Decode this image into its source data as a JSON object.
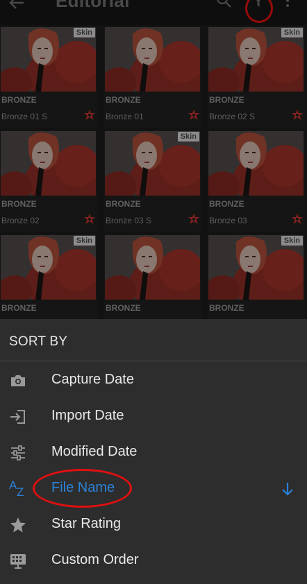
{
  "header": {
    "title": "Editorial",
    "icons": [
      "back-arrow-icon",
      "search-icon",
      "filter-icon",
      "more-vertical-icon"
    ]
  },
  "grid": {
    "tiles": [
      {
        "badge": "Skin",
        "category": "BRONZE",
        "name": "Bronze 01 S"
      },
      {
        "badge": "",
        "category": "BRONZE",
        "name": "Bronze 01"
      },
      {
        "badge": "Skin",
        "category": "BRONZE",
        "name": "Bronze 02 S"
      },
      {
        "badge": "",
        "category": "BRONZE",
        "name": "Bronze 02"
      },
      {
        "badge": "Skin",
        "category": "BRONZE",
        "name": "Bronze 03 S"
      },
      {
        "badge": "",
        "category": "BRONZE",
        "name": "Bronze 03"
      },
      {
        "badge": "Skin",
        "category": "BRONZE",
        "name": ""
      },
      {
        "badge": "",
        "category": "BRONZE",
        "name": ""
      },
      {
        "badge": "Skin",
        "category": "BRONZE",
        "name": ""
      }
    ]
  },
  "sort_sheet": {
    "title": "SORT BY",
    "options": [
      {
        "label": "Capture Date",
        "icon": "camera-icon",
        "active": false
      },
      {
        "label": "Import Date",
        "icon": "import-icon",
        "active": false
      },
      {
        "label": "Modified Date",
        "icon": "sliders-icon",
        "active": false
      },
      {
        "label": "File Name",
        "icon": "az-icon",
        "active": true
      },
      {
        "label": "Star Rating",
        "icon": "star-icon",
        "active": false
      },
      {
        "label": "Custom Order",
        "icon": "custom-order-icon",
        "active": false
      }
    ],
    "sort_direction_icon": "arrow-down-icon"
  },
  "colors": {
    "accent_blue": "#2b82d9",
    "annotation_red": "#e01010",
    "sheet_bg": "#2d2d2d",
    "flag_red": "#c0332b"
  }
}
